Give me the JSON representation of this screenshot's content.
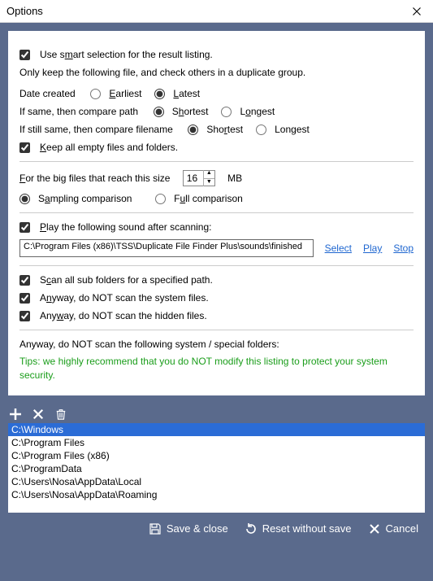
{
  "window": {
    "title": "Options"
  },
  "smart": {
    "checkbox_label": "Use smart selection for the result listing.",
    "description": "Only keep the following file, and check others in a duplicate group.",
    "date_created_label": "Date created",
    "radio_earliest": "Earliest",
    "radio_latest": "Latest",
    "date_selected": "latest",
    "compare_path_label": "If same, then compare path",
    "path_shortest": "Shortest",
    "path_longest": "Longest",
    "path_selected": "shortest",
    "compare_filename_label": "If still same, then compare filename",
    "fn_shortest": "Shortest",
    "fn_longest": "Longest",
    "fn_selected": "shortest",
    "keep_empty_label": "Keep all empty files and folders."
  },
  "bigfiles": {
    "prefix_label": "For the big files that reach this size",
    "value": "16",
    "unit": "MB",
    "radio_sampling": "Sampling comparison",
    "radio_full": "Full comparison",
    "selected": "sampling"
  },
  "sound": {
    "checkbox_label": "Play the following sound after scanning:",
    "path": "C:\\Program Files (x86)\\TSS\\Duplicate File Finder Plus\\sounds\\finished",
    "link_select": "Select",
    "link_play": "Play",
    "link_stop": "Stop"
  },
  "scan": {
    "sub_label": "Scan all sub folders for a specified path.",
    "sys_label": "Anyway, do NOT scan the system files.",
    "hidden_label": "Anyway, do NOT scan the hidden files."
  },
  "exclude": {
    "heading": "Anyway, do NOT scan the following system / special folders:",
    "tips": "Tips: we highly recommend that you do NOT modify this listing to protect your system security.",
    "items": [
      "C:\\Windows",
      "C:\\Program Files",
      "C:\\Program Files (x86)",
      "C:\\ProgramData",
      "C:\\Users\\Nosa\\AppData\\Local",
      "C:\\Users\\Nosa\\AppData\\Roaming"
    ],
    "selected_index": 0
  },
  "footer": {
    "save": "Save & close",
    "reset": "Reset without save",
    "cancel": "Cancel"
  }
}
